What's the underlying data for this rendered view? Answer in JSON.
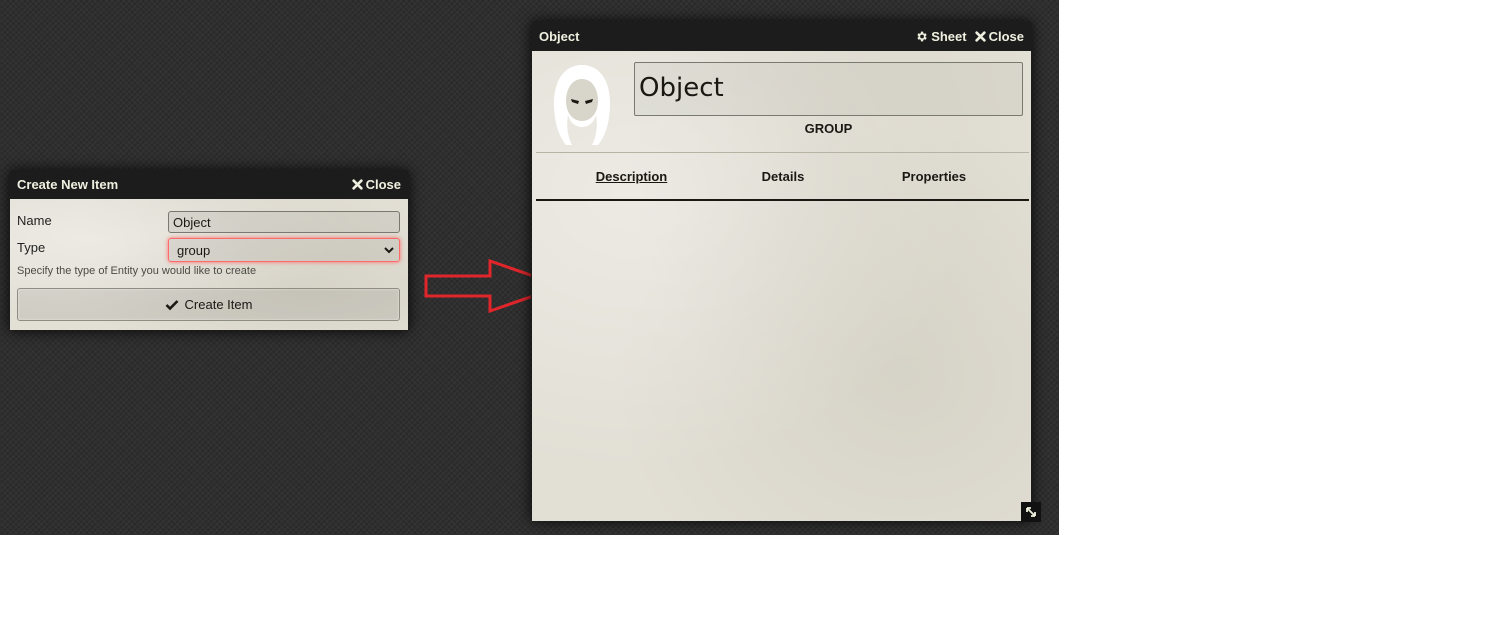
{
  "create_dialog": {
    "title": "Create New Item",
    "close_label": "Close",
    "name_label": "Name",
    "name_value": "Object",
    "type_label": "Type",
    "type_value": "group",
    "hint": "Specify the type of Entity you would like to create",
    "create_label": "Create Item"
  },
  "sheet": {
    "title": "Object",
    "sheet_label": "Sheet",
    "close_label": "Close",
    "name_value": "Object",
    "item_type": "GROUP",
    "tabs": [
      {
        "label": "Description",
        "active": true
      },
      {
        "label": "Details",
        "active": false
      },
      {
        "label": "Properties",
        "active": false
      }
    ]
  },
  "colors": {
    "canvas": "#2f2f2f",
    "parchment": "#e2dfd5",
    "arrow": "#e0262b",
    "select_focus": "#ff6a6a"
  },
  "icons": [
    "close-icon",
    "gear-icon",
    "check-icon",
    "chevron-down-icon",
    "hooded-figure-icon",
    "resize-icon",
    "right-arrow-icon"
  ]
}
